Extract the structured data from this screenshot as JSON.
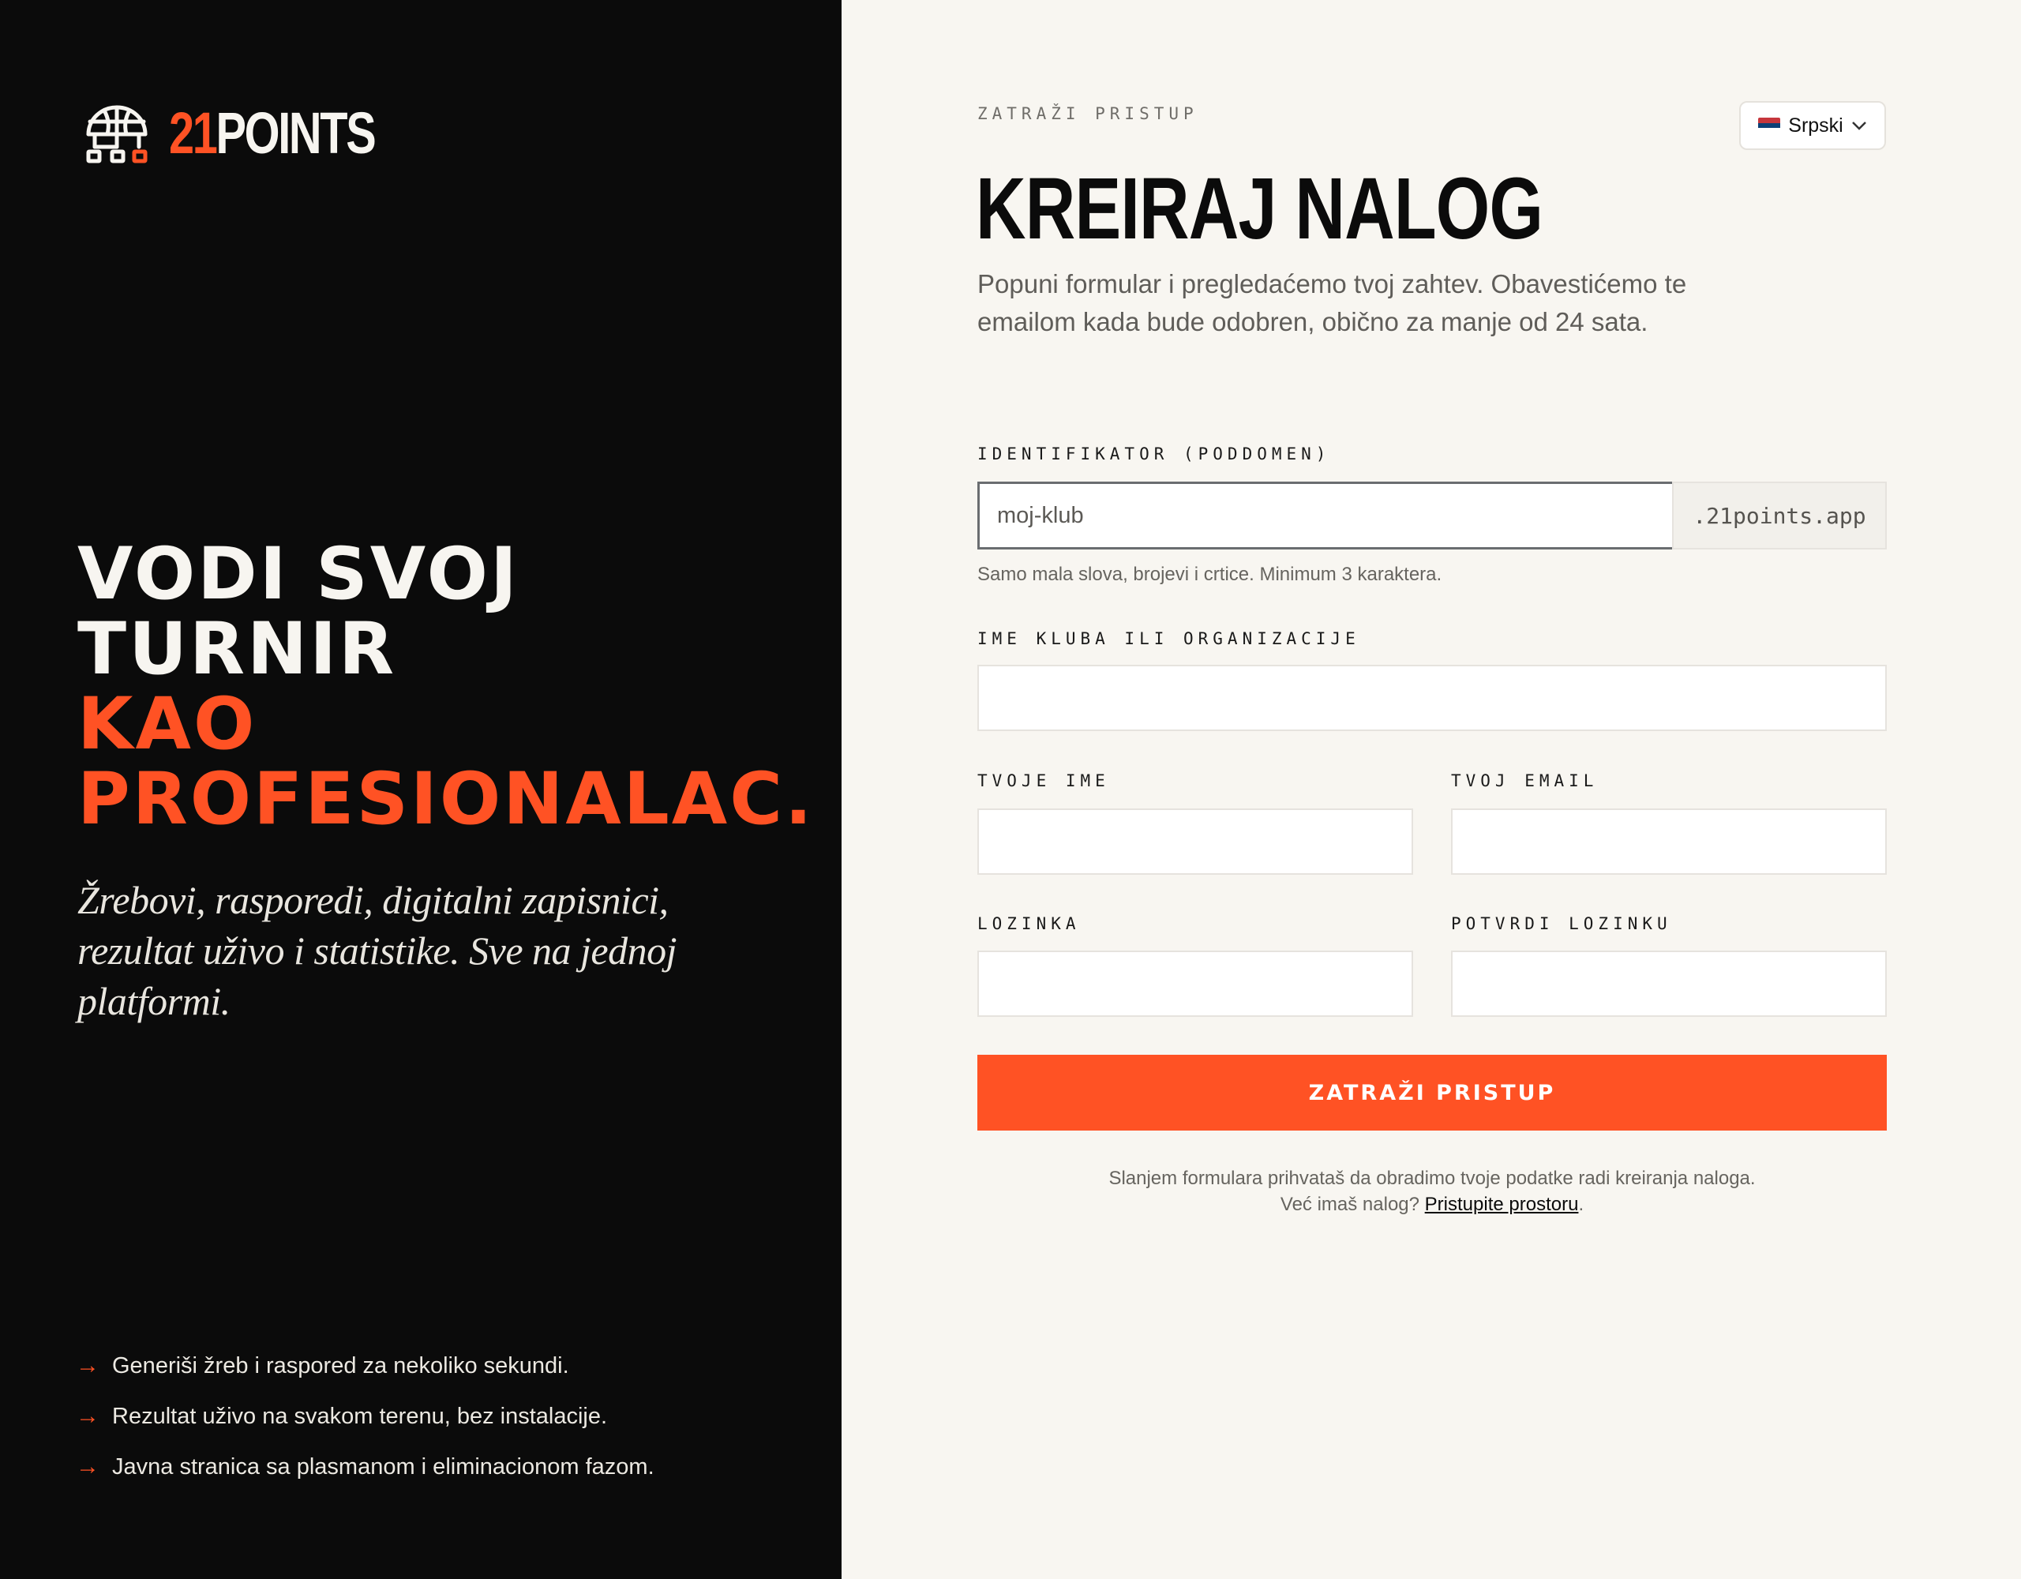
{
  "brand": {
    "number": "21",
    "word": "POINTS",
    "logo_icon": "basketball-bracket-icon"
  },
  "hero": {
    "lines_white": [
      "VODI SVOJ",
      "TURNIR"
    ],
    "lines_orange": [
      "KAO",
      "PROFESIONALAC."
    ]
  },
  "lede": "Žrebovi, rasporedi, digitalni zapisnici, rezultat uživo i statistike. Sve na jednoj platformi.",
  "features": [
    "Generiši žreb i raspored za nekoliko sekundi.",
    "Rezultat uživo na svakom terenu, bez instalacije.",
    "Javna stranica sa plasmanom i eliminacionom fazom."
  ],
  "form": {
    "eyebrow": "ZATRAŽI PRISTUP",
    "title": "KREIRAJ NALOG",
    "subtitle": "Popuni formular i pregledaćemo tvoj zahtev. Obavestićemo te emailom kada bude odobren, obično za manje od 24 sata.",
    "language": {
      "label": "Srpski",
      "flag_colors": [
        "#c6363c",
        "#0c4076",
        "#ffffff"
      ]
    },
    "subdomain": {
      "label": "IDENTIFIKATOR (PODDOMEN)",
      "placeholder": "moj-klub",
      "suffix": ".21points.app",
      "hint": "Samo mala slova, brojevi i crtice. Minimum 3 karaktera."
    },
    "club": {
      "label": "IME KLUBA ILI ORGANIZACIJE"
    },
    "name": {
      "label": "TVOJE IME"
    },
    "email": {
      "label": "TVOJ EMAIL"
    },
    "password": {
      "label": "LOZINKA"
    },
    "password_confirm": {
      "label": "POTVRDI LOZINKU"
    },
    "submit_label": "ZATRAŽI PRISTUP",
    "legal_text": "Slanjem formulara prihvataš da obradimo tvoje podatke radi kreiranja naloga.",
    "login_prompt": "Već imaš nalog?",
    "login_link": "Pristupite prostoru",
    "login_suffix": "."
  },
  "colors": {
    "accent": "#ff5224",
    "dark": "#0b0b0b",
    "paper": "#f8f6f1"
  }
}
